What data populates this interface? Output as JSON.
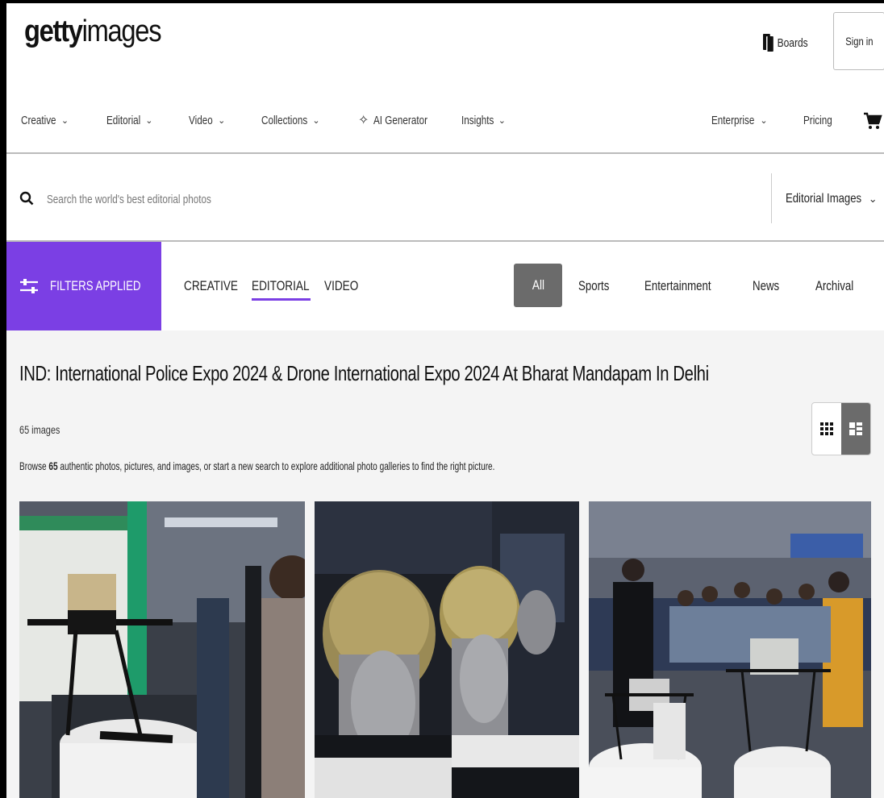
{
  "header": {
    "logo_bold": "getty",
    "logo_light": "images",
    "boards_label": "Boards",
    "signin_label": "Sign in"
  },
  "nav": {
    "items": [
      {
        "label": "Creative",
        "has_chevron": true
      },
      {
        "label": "Editorial",
        "has_chevron": true
      },
      {
        "label": "Video",
        "has_chevron": true
      },
      {
        "label": "Collections",
        "has_chevron": true
      },
      {
        "label": "AI Generator",
        "has_chevron": false,
        "icon": "sparkle-icon"
      },
      {
        "label": "Insights",
        "has_chevron": true
      }
    ],
    "right_items": [
      {
        "label": "Enterprise",
        "has_chevron": true
      },
      {
        "label": "Pricing",
        "has_chevron": false
      }
    ]
  },
  "search": {
    "placeholder": "Search the world's best editorial photos",
    "type_label": "Editorial Images"
  },
  "filters": {
    "button_label": "FILTERS APPLIED",
    "type_tabs": [
      "CREATIVE",
      "EDITORIAL",
      "VIDEO"
    ],
    "active_type_tab": "EDITORIAL",
    "categories": [
      "All",
      "Sports",
      "Entertainment",
      "News",
      "Archival"
    ],
    "active_category": "All"
  },
  "content": {
    "title": "IND: International Police Expo 2024 & Drone International Expo 2024 At Bharat Mandapam In Delhi",
    "count_label": "65 images",
    "browse_prefix": "Browse ",
    "browse_count": "65",
    "browse_suffix": " authentic photos, pictures, and images, or start a new search to explore additional photo galleries to find the right picture.",
    "view_mode": "mosaic"
  },
  "colors": {
    "accent": "#7b3fe4",
    "active_gray": "#6b6b6b",
    "content_bg": "#f4f4f4"
  }
}
